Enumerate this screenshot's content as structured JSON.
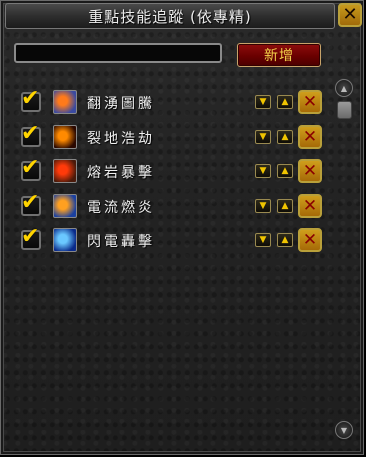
{
  "window": {
    "title": "重點技能追蹤 (依專精)",
    "close_label": "✕"
  },
  "toolbar": {
    "input_value": "",
    "input_placeholder": "",
    "add_label": "新增"
  },
  "skills": [
    {
      "name": "翻湧圖騰",
      "checked": true,
      "icon": "totem-icon",
      "icon_colors": [
        "#ff7a1a",
        "#3a4aa0"
      ]
    },
    {
      "name": "裂地浩劫",
      "checked": true,
      "icon": "earthquake-icon",
      "icon_colors": [
        "#ff8a00",
        "#2a0800"
      ]
    },
    {
      "name": "熔岩暴擊",
      "checked": true,
      "icon": "lava-burst-icon",
      "icon_colors": [
        "#ff3a0a",
        "#4a1a0a"
      ]
    },
    {
      "name": "電流燃炎",
      "checked": true,
      "icon": "flame-shock-icon",
      "icon_colors": [
        "#ffa020",
        "#1a40a0"
      ]
    },
    {
      "name": "閃電轟擊",
      "checked": true,
      "icon": "lightning-bolt-icon",
      "icon_colors": [
        "#6ac8ff",
        "#0a2a8a"
      ]
    }
  ],
  "controls": {
    "move_down_glyph": "▼",
    "move_up_glyph": "▲",
    "delete_glyph": "✕",
    "check_glyph": "✔"
  },
  "scroll": {
    "up_glyph": "▲",
    "down_glyph": "▼"
  }
}
